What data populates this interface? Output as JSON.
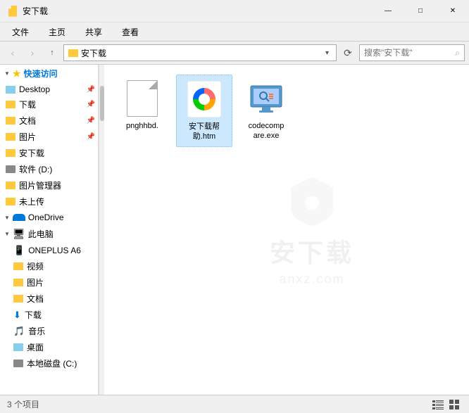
{
  "window": {
    "title": "安下载",
    "controls": {
      "minimize": "—",
      "maximize": "□",
      "close": "✕"
    }
  },
  "ribbon": {
    "tabs": [
      "文件",
      "主页",
      "共享",
      "查看"
    ]
  },
  "addressbar": {
    "path": "安下载",
    "search_placeholder": "搜索\"安下载\"",
    "back": "‹",
    "forward": "›",
    "up": "↑"
  },
  "sidebar": {
    "quickaccess_label": "快速访问",
    "items": [
      {
        "id": "desktop",
        "label": "Desktop",
        "pinned": true,
        "type": "folder"
      },
      {
        "id": "download",
        "label": "下载",
        "pinned": true,
        "type": "folder-download"
      },
      {
        "id": "docs",
        "label": "文档",
        "pinned": true,
        "type": "folder"
      },
      {
        "id": "pics",
        "label": "图片",
        "pinned": true,
        "type": "folder"
      },
      {
        "id": "anxia",
        "label": "安下载",
        "type": "folder"
      },
      {
        "id": "software-d",
        "label": "软件 (D:)",
        "type": "drive"
      },
      {
        "id": "imgmgr",
        "label": "图片管理器",
        "type": "folder"
      },
      {
        "id": "notup",
        "label": "未上传",
        "type": "folder"
      },
      {
        "id": "onedrive",
        "label": "OneDrive",
        "type": "onedrive"
      },
      {
        "id": "thispc",
        "label": "此电脑",
        "type": "computer"
      },
      {
        "id": "oneplus",
        "label": "ONEPLUS A6",
        "type": "phone"
      },
      {
        "id": "video",
        "label": "视频",
        "type": "folder"
      },
      {
        "id": "pics2",
        "label": "图片",
        "type": "folder"
      },
      {
        "id": "docs2",
        "label": "文档",
        "type": "folder"
      },
      {
        "id": "down2",
        "label": "下载",
        "type": "download"
      },
      {
        "id": "music",
        "label": "音乐",
        "type": "music"
      },
      {
        "id": "desktop2",
        "label": "桌面",
        "type": "folder-blue"
      }
    ]
  },
  "files": [
    {
      "id": "pnghhbd",
      "name": "pnghhbd.",
      "type": "generic",
      "selected": false
    },
    {
      "id": "anzaixia",
      "name": "安下载帮助.htm",
      "type": "htm",
      "selected": true
    },
    {
      "id": "codecompare",
      "name": "codecomp are.exe",
      "type": "exe",
      "selected": false
    }
  ],
  "statusbar": {
    "count": "3 个项目",
    "selected": ""
  },
  "watermark": {
    "text_cn": "安下载",
    "text_en": "anxz.com"
  }
}
